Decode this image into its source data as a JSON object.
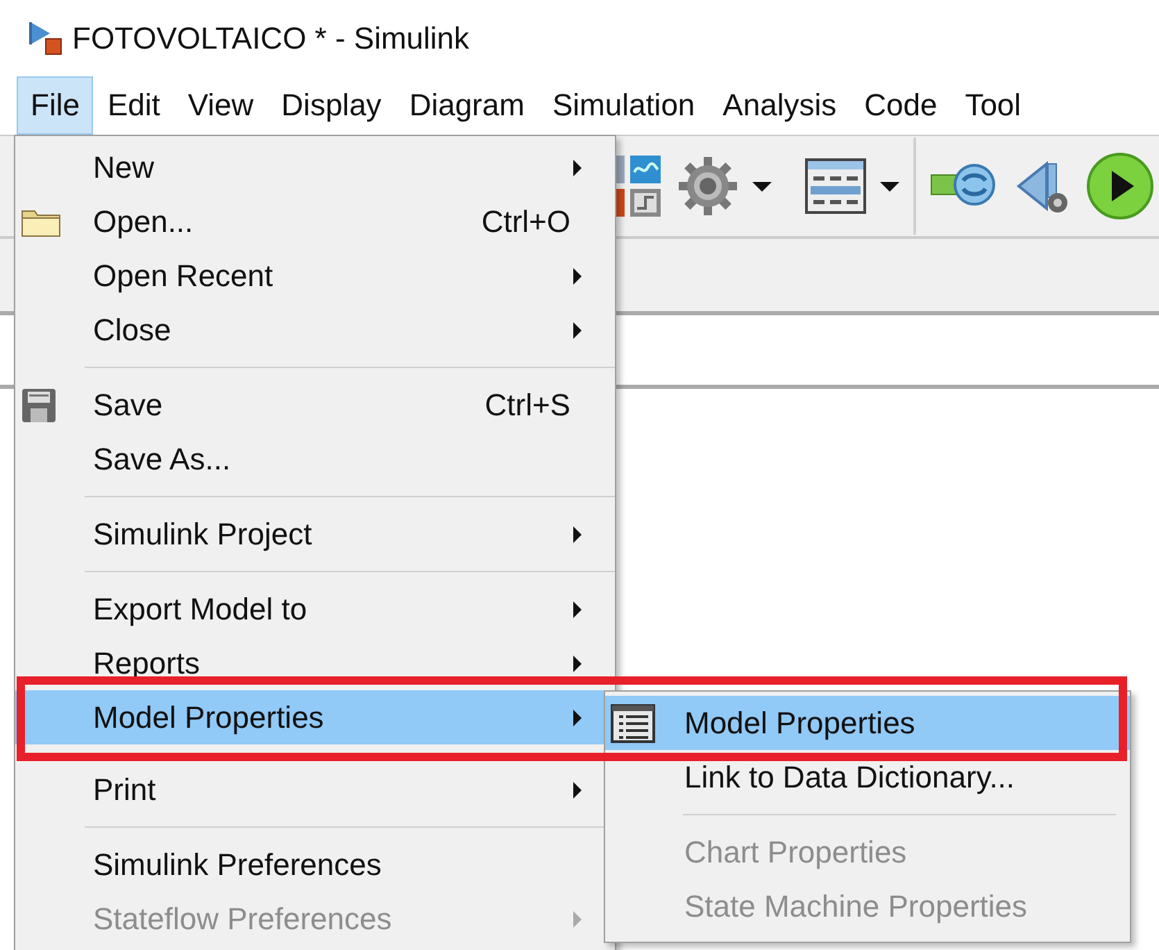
{
  "window": {
    "title": "FOTOVOLTAICO * - Simulink"
  },
  "menu_bar": [
    {
      "label": "File",
      "selected": true
    },
    {
      "label": "Edit",
      "selected": false
    },
    {
      "label": "View",
      "selected": false
    },
    {
      "label": "Display",
      "selected": false
    },
    {
      "label": "Diagram",
      "selected": false
    },
    {
      "label": "Simulation",
      "selected": false
    },
    {
      "label": "Analysis",
      "selected": false
    },
    {
      "label": "Code",
      "selected": false
    },
    {
      "label": "Tool",
      "selected": false
    }
  ],
  "file_menu": {
    "items": [
      {
        "kind": "item",
        "label": "New",
        "submenu": true,
        "selected": false,
        "disabled": false
      },
      {
        "kind": "item",
        "label": "Open...",
        "shortcut": "Ctrl+O",
        "submenu": false,
        "selected": false,
        "disabled": false
      },
      {
        "kind": "item",
        "label": "Open Recent",
        "submenu": true,
        "selected": false,
        "disabled": false
      },
      {
        "kind": "item",
        "label": "Close",
        "submenu": true,
        "selected": false,
        "disabled": false
      },
      {
        "kind": "separator"
      },
      {
        "kind": "item",
        "label": "Save",
        "shortcut": "Ctrl+S",
        "submenu": false,
        "selected": false,
        "disabled": false
      },
      {
        "kind": "item",
        "label": "Save As...",
        "submenu": false,
        "selected": false,
        "disabled": false
      },
      {
        "kind": "separator"
      },
      {
        "kind": "item",
        "label": "Simulink Project",
        "submenu": true,
        "selected": false,
        "disabled": false
      },
      {
        "kind": "separator"
      },
      {
        "kind": "item",
        "label": "Export Model to",
        "submenu": true,
        "selected": false,
        "disabled": false
      },
      {
        "kind": "item",
        "label": "Reports",
        "submenu": true,
        "selected": false,
        "disabled": false
      },
      {
        "kind": "item",
        "label": "Model Properties",
        "submenu": true,
        "selected": true,
        "disabled": false
      },
      {
        "kind": "item",
        "label": "Print",
        "submenu": true,
        "selected": false,
        "disabled": false
      },
      {
        "kind": "separator"
      },
      {
        "kind": "item",
        "label": "Simulink Preferences",
        "submenu": false,
        "selected": false,
        "disabled": false
      },
      {
        "kind": "item",
        "label": "Stateflow Preferences",
        "submenu": true,
        "selected": false,
        "disabled": true
      }
    ]
  },
  "model_properties_menu": {
    "items": [
      {
        "kind": "item",
        "label": "Model Properties",
        "selected": true,
        "disabled": false
      },
      {
        "kind": "item",
        "label": "Link to Data Dictionary...",
        "selected": false,
        "disabled": false
      },
      {
        "kind": "separator"
      },
      {
        "kind": "item",
        "label": "Chart Properties",
        "selected": false,
        "disabled": true
      },
      {
        "kind": "item",
        "label": "State Machine Properties",
        "selected": false,
        "disabled": true
      }
    ]
  }
}
